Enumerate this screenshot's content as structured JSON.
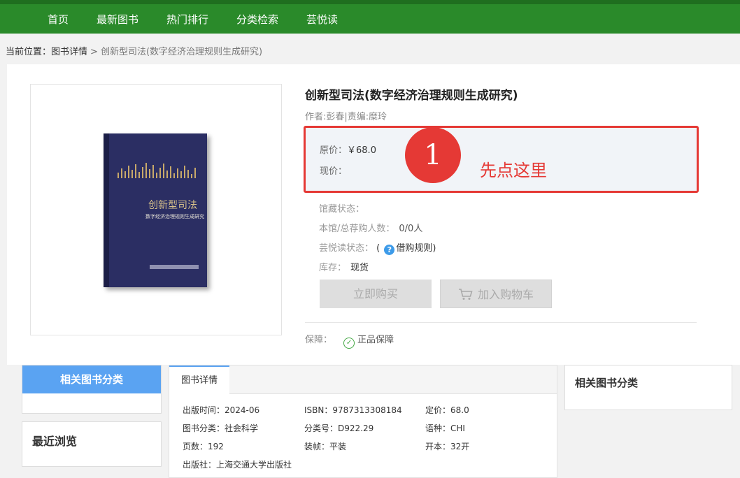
{
  "nav": {
    "items": [
      {
        "label": "首页"
      },
      {
        "label": "最新图书"
      },
      {
        "label": "热门排行"
      },
      {
        "label": "分类检索"
      },
      {
        "label": "芸悦读"
      }
    ]
  },
  "breadcrumb": {
    "prefix": "当前位置：",
    "parent": "图书详情",
    "separator": ">",
    "current": "创新型司法(数字经济治理规则生成研究)"
  },
  "cover": {
    "title_art": "创新型司法",
    "subtitle_art": "数字经济治理规则生成研究"
  },
  "book": {
    "title": "创新型司法(数字经济治理规则生成研究)",
    "author_line": "作者:彭春|责编:糜玲"
  },
  "price": {
    "original_label": "原价：",
    "original_value": "￥68.0",
    "current_label": "现价："
  },
  "annotation": {
    "step_number": "1",
    "text": "先点这里",
    "color": "#e53935"
  },
  "info": {
    "collection_label": "馆藏状态：",
    "buyers_label": "本馆/总荐购人数：",
    "buyers_value": "0/0人",
    "yunyuedu_label": "芸悦读状态：",
    "yunyuedu_open": "(",
    "borrow_rules": "借购规则)",
    "stock_label": "库存：",
    "stock_value": "现货"
  },
  "buttons": {
    "buy": "立即购买",
    "cart": "加入购物车"
  },
  "guarantee": {
    "label": "保障：",
    "value": "正品保障"
  },
  "sidebar": {
    "related_title": "相关图书分类",
    "recent_title": "最近浏览"
  },
  "details": {
    "tab": "图书详情",
    "rows": [
      [
        "出版时间：2024-06",
        "ISBN：9787313308184",
        "定价：68.0"
      ],
      [
        "图书分类：社会科学",
        "分类号：D922.29",
        "语种：CHI"
      ],
      [
        "页数：192",
        "装帧：平装",
        "开本：32开"
      ],
      [
        "出版社：上海交通大学出版社"
      ]
    ]
  },
  "right_panel": {
    "title": "相关图书分类"
  },
  "colors": {
    "nav_green": "#2a8a2a",
    "accent_blue": "#5aa3f2",
    "annotation_red": "#e53935"
  }
}
